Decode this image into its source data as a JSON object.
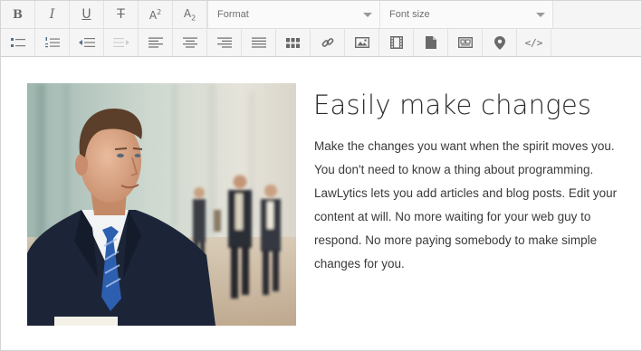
{
  "toolbar": {
    "row1": {
      "bold_label": "B",
      "italic_label": "I",
      "underline_label": "U",
      "strike_label": "T",
      "superscript_label": "A",
      "superscript_mark": "2",
      "subscript_label": "A",
      "subscript_mark": "2",
      "format_select": {
        "value": "Format"
      },
      "fontsize_select": {
        "value": "Font size"
      }
    },
    "row2": {
      "icons": [
        "bulleted-list-icon",
        "numbered-list-icon",
        "outdent-icon",
        "indent-icon",
        "align-left-icon",
        "align-center-icon",
        "align-right-icon",
        "justify-icon",
        "table-icon",
        "link-icon",
        "image-icon",
        "video-icon",
        "file-icon",
        "embed-icon",
        "map-pin-icon",
        "code-view-icon"
      ],
      "code_label": "</>"
    }
  },
  "content": {
    "headline": "Easily make changes",
    "paragraph": "Make the changes you want when the spirit moves you. You don't need to know a thing about programming. LawLytics lets you add articles and blog posts. Edit your content at will. No more waiting for your web guy to respond. No more paying somebody to make simple changes for you."
  },
  "colors": {
    "toolbar_bg": "#f5f5f5",
    "icon_gray": "#6d6d6d",
    "disabled_icon": "#c4c4c4",
    "headline": "#2b2b2b",
    "body_text": "#3a3a3a",
    "suit_navy": "#1c2538",
    "tie_blue": "#2d5fb0"
  }
}
